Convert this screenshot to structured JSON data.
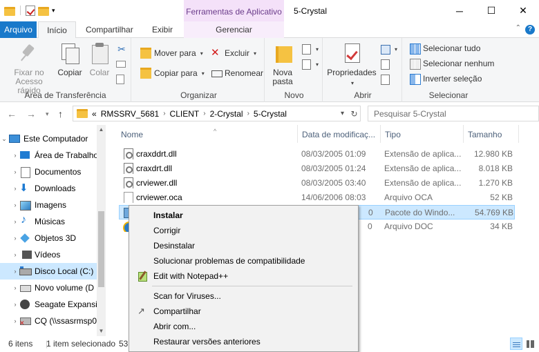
{
  "title_bar": {
    "context_tab_title": "Ferramentas de Aplicativo",
    "window_title": "5-Crystal",
    "minimize": "─",
    "maximize": "☐",
    "close": "✕"
  },
  "ribbon_tabs": {
    "file": "Arquivo",
    "home": "Início",
    "share": "Compartilhar",
    "view": "Exibir",
    "manage": "Gerenciar"
  },
  "ribbon": {
    "clipboard": {
      "label": "Área de Transferência",
      "pin_line1": "Fixar no",
      "pin_line2": "Acesso rápido",
      "copy": "Copiar",
      "paste": "Colar"
    },
    "organize": {
      "label": "Organizar",
      "move_to": "Mover para",
      "copy_to": "Copiar para",
      "delete": "Excluir",
      "rename": "Renomear"
    },
    "new": {
      "label": "Novo",
      "new_folder_line1": "Nova",
      "new_folder_line2": "pasta"
    },
    "open": {
      "label": "Abrir",
      "properties": "Propriedades"
    },
    "select": {
      "label": "Selecionar",
      "select_all": "Selecionar tudo",
      "select_none": "Selecionar nenhum",
      "invert": "Inverter seleção"
    }
  },
  "address": {
    "prefix": "«",
    "crumbs": [
      "RMSSRV_5681",
      "CLIENT",
      "2-Crystal",
      "5-Crystal"
    ],
    "search_placeholder": "Pesquisar 5-Crystal"
  },
  "nav_pane": {
    "items": [
      {
        "label": "Este Computador",
        "icon": "pc-icon"
      },
      {
        "label": "Área de Trabalho",
        "icon": "desktop-icon"
      },
      {
        "label": "Documentos",
        "icon": "documents-icon"
      },
      {
        "label": "Downloads",
        "icon": "downloads-icon"
      },
      {
        "label": "Imagens",
        "icon": "pictures-icon"
      },
      {
        "label": "Músicas",
        "icon": "music-icon"
      },
      {
        "label": "Objetos 3D",
        "icon": "3d-objects-icon"
      },
      {
        "label": "Vídeos",
        "icon": "videos-icon"
      },
      {
        "label": "Disco Local (C:)",
        "icon": "local-disk-icon"
      },
      {
        "label": "Novo volume (D",
        "icon": "drive-icon"
      },
      {
        "label": "Seagate Expansio",
        "icon": "seagate-drive-icon"
      },
      {
        "label": "CQ (\\\\ssasrmsp0",
        "icon": "network-drive-icon"
      }
    ]
  },
  "columns": {
    "name": "Nome",
    "date": "Data de modificaç...",
    "type": "Tipo",
    "size": "Tamanho"
  },
  "files": [
    {
      "name": "craxddrt.dll",
      "date": "08/03/2005 01:09",
      "type": "Extensão de aplica...",
      "size": "12.980 KB"
    },
    {
      "name": "craxdrt.dll",
      "date": "08/03/2005 01:24",
      "type": "Extensão de aplica...",
      "size": "8.018 KB"
    },
    {
      "name": "crviewer.dll",
      "date": "08/03/2005 03:40",
      "type": "Extensão de aplica...",
      "size": "1.270 KB"
    },
    {
      "name": "crviewer.oca",
      "date": "14/06/2006 08:03",
      "type": "Arquivo OCA",
      "size": "52 KB"
    },
    {
      "name": "",
      "date": "0",
      "type": "Pacote do Windo...",
      "size": "54.769 KB"
    },
    {
      "name": "",
      "date": "0",
      "type": "Arquivo DOC",
      "size": "34 KB"
    }
  ],
  "status": {
    "count": "6 itens",
    "selected": "1 item selecionado",
    "size": "53,"
  },
  "context_menu": {
    "install": "Instalar",
    "repair": "Corrigir",
    "uninstall": "Desinstalar",
    "troubleshoot": "Solucionar problemas de compatibilidade",
    "notepad": "Edit with Notepad++",
    "scan": "Scan for Viruses...",
    "share": "Compartilhar",
    "open_with": "Abrir com...",
    "restore": "Restaurar versões anteriores"
  }
}
